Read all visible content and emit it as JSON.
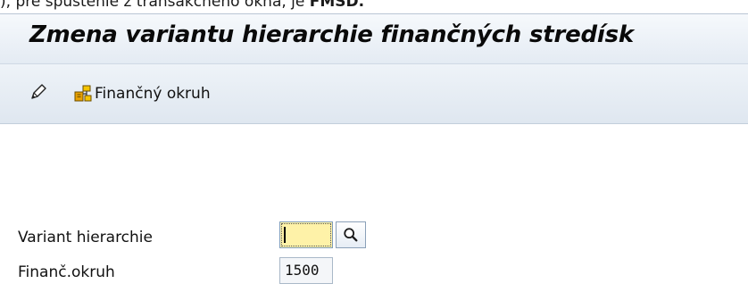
{
  "doc_text": {
    "prefix": "), pre spustenie z transakčného okna, je ",
    "code": "FMSD."
  },
  "window": {
    "title": "Zmena variantu hierarchie finančných stredísk"
  },
  "toolbar": {
    "edit_icon": "pencil-icon",
    "org_icon": "hierarchy-icon",
    "org_label": "Finančný okruh"
  },
  "form": {
    "variant_label": "Variant hierarchie",
    "variant_value": "",
    "search_icon": "magnifier-icon",
    "okruh_label": "Finanč.okruh",
    "okruh_value": "1500"
  },
  "colors": {
    "required_field": "#fef2a8",
    "title_bar": "#e4ebf3",
    "toolbar": "#dfe7f0"
  }
}
